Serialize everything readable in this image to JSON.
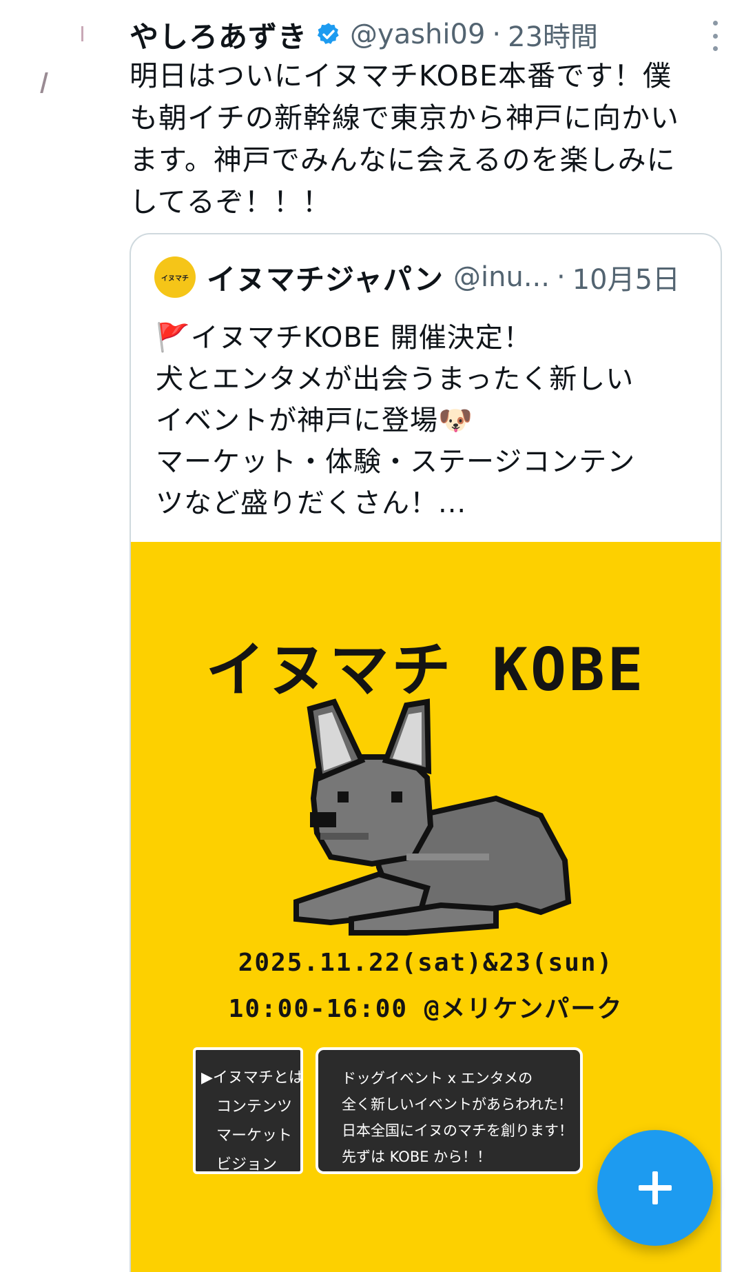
{
  "tweet": {
    "display_name": "やしろあずき",
    "verified": true,
    "handle": "@yashi09",
    "separator": "·",
    "timestamp": "23時間",
    "text": "明日はついにイヌマチKOBE本番です！僕\nも朝イチの新幹線で東京から神戸に向かい\nます。神戸でみんなに会えるのを楽しみに\nしてるぞ！！！",
    "more_icon": "more-vertical-icon"
  },
  "quote": {
    "avatar_label": "イヌマチ",
    "display_name": "イヌマチジャパン",
    "handle": "@inu...",
    "separator": "·",
    "timestamp": "10月5日",
    "text": "🚩イヌマチKOBE 開催決定！\n犬とエンタメが出会うまったく新しい\nイベントが神戸に登場🐶\nマーケット・体験・ステージコンテン\nツなど盛りだくさん！..."
  },
  "poster": {
    "title": "イヌマチ KOBE",
    "date": "2025.11.22(sat)&23(sun)",
    "time": "10:00-16:00 @メリケンパーク",
    "menu": [
      "▶イヌマチとは",
      "コンテンツ",
      "マーケット",
      "ビジョン"
    ],
    "message_lines": [
      "ドッグイベント x エンタメの",
      "全く新しいイベントがあらわれた！",
      "日本全国にイヌのマチを創ります！",
      "先ずは KOBE から！！"
    ],
    "background_color": "#fdd000"
  },
  "fab": {
    "icon": "plus-icon",
    "color": "#1d9bf0"
  },
  "colors": {
    "text": "#0f1419",
    "secondary": "#536471",
    "verified": "#1d9bf0",
    "border": "#cfd9de"
  }
}
